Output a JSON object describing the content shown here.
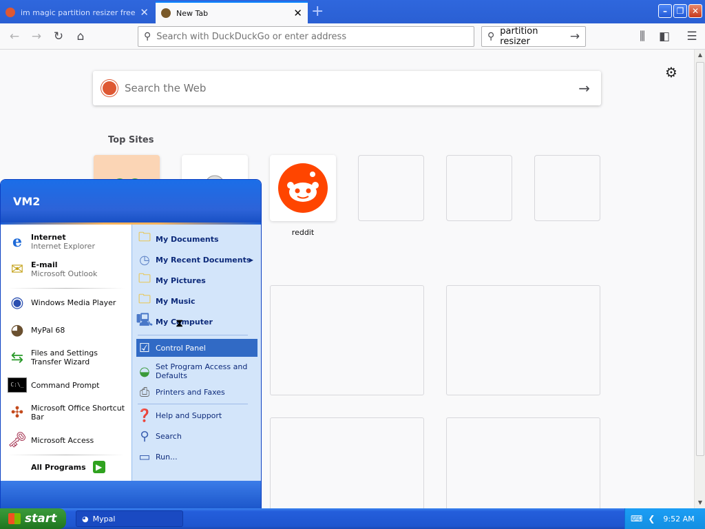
{
  "browser": {
    "tabs": [
      {
        "title": "im magic partition resizer free at l",
        "favicon_color": "#de5833",
        "active": false
      },
      {
        "title": "New Tab",
        "favicon_color": "#7a5a2a",
        "active": true
      }
    ],
    "new_tab_glyph": "+",
    "url_placeholder": "Search with DuckDuckGo or enter address",
    "search_value": "partition resizer",
    "window_buttons": {
      "minimize": "–",
      "restore": "❐",
      "close": "✕"
    }
  },
  "newtab": {
    "websearch_placeholder": "Search the Web",
    "top_sites_label": "Top Sites",
    "reddit_label": "reddit",
    "accent": "#ff4500"
  },
  "startmenu": {
    "user": "VM2",
    "pinned": [
      {
        "title": "Internet",
        "subtitle": "Internet Explorer",
        "icon": "ie-icon"
      },
      {
        "title": "E-mail",
        "subtitle": "Microsoft Outlook",
        "icon": "outlook-icon"
      }
    ],
    "recent": [
      {
        "label": "Windows Media Player",
        "icon": "media-player-icon"
      },
      {
        "label": "MyPal 68",
        "icon": "mypal-icon"
      },
      {
        "label": "Files and Settings Transfer Wizard",
        "icon": "transfer-wizard-icon"
      },
      {
        "label": "Command Prompt",
        "icon": "command-prompt-icon"
      },
      {
        "label": "Microsoft Office Shortcut Bar",
        "icon": "office-shortcut-icon"
      },
      {
        "label": "Microsoft Access",
        "icon": "access-icon"
      }
    ],
    "all_programs": "All Programs",
    "right": [
      {
        "label": "My Documents",
        "bold": true
      },
      {
        "label": "My Recent Documents",
        "bold": true
      },
      {
        "label": "My Pictures",
        "bold": true
      },
      {
        "label": "My Music",
        "bold": true
      },
      {
        "label": "My Computer",
        "bold": true
      },
      {
        "label": "Control Panel",
        "bold": false
      },
      {
        "label": "Set Program Access and Defaults",
        "bold": false
      },
      {
        "label": "Printers and Faxes",
        "bold": false
      },
      {
        "label": "Help and Support",
        "bold": false
      },
      {
        "label": "Search",
        "bold": false
      },
      {
        "label": "Run...",
        "bold": false
      }
    ]
  },
  "taskbar": {
    "start_label": "start",
    "task_label": "Mypal",
    "clock": "9:52 AM"
  }
}
